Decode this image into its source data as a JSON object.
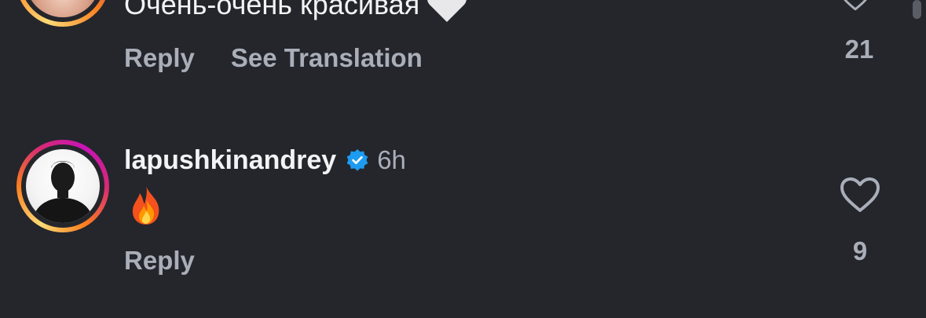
{
  "comments": [
    {
      "text": "Очень-очень красивая",
      "emoji": "white-heart",
      "actions": {
        "reply": "Reply",
        "translate": "See Translation"
      },
      "likes": "21"
    },
    {
      "username": "lapushkinandrey",
      "verified": true,
      "time": "6h",
      "emoji": "fire",
      "actions": {
        "reply": "Reply"
      },
      "likes": "9"
    }
  ],
  "colors": {
    "background": "#24262c",
    "primary_text": "#f2f3f5",
    "secondary_text": "#a9aeb8",
    "verified_badge": "#1d9bf0",
    "story_ring_start": "#feda75",
    "story_ring_end": "#d62976"
  }
}
